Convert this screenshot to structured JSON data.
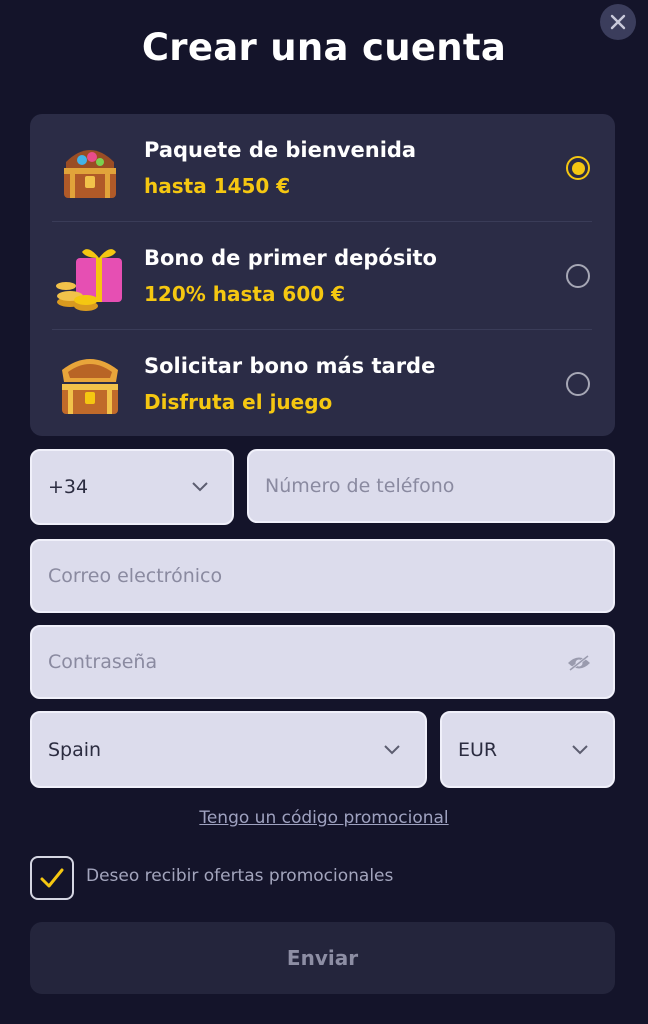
{
  "title": "Crear una cuenta",
  "bonuses": [
    {
      "label": "Paquete de bienvenida",
      "sub": "hasta 1450 €",
      "icon": "treasure-chest-icon",
      "selected": true
    },
    {
      "label": "Bono de primer depósito",
      "sub": "120% hasta 600 €",
      "icon": "gift-coins-icon",
      "selected": false
    },
    {
      "label": "Solicitar bono más tarde",
      "sub": "Disfruta el juego",
      "icon": "open-chest-icon",
      "selected": false
    }
  ],
  "form": {
    "phone_code": "+34",
    "phone_placeholder": "Número de teléfono",
    "email_placeholder": "Correo electrónico",
    "password_placeholder": "Contraseña",
    "country": "Spain",
    "currency": "EUR"
  },
  "promo_link": "Tengo un código promocional",
  "offers_label": "Deseo recibir ofertas promocionales",
  "offers_checked": true,
  "submit_label": "Enviar",
  "colors": {
    "accent": "#f5c711",
    "background": "#14142a",
    "panel": "#2b2c46"
  }
}
